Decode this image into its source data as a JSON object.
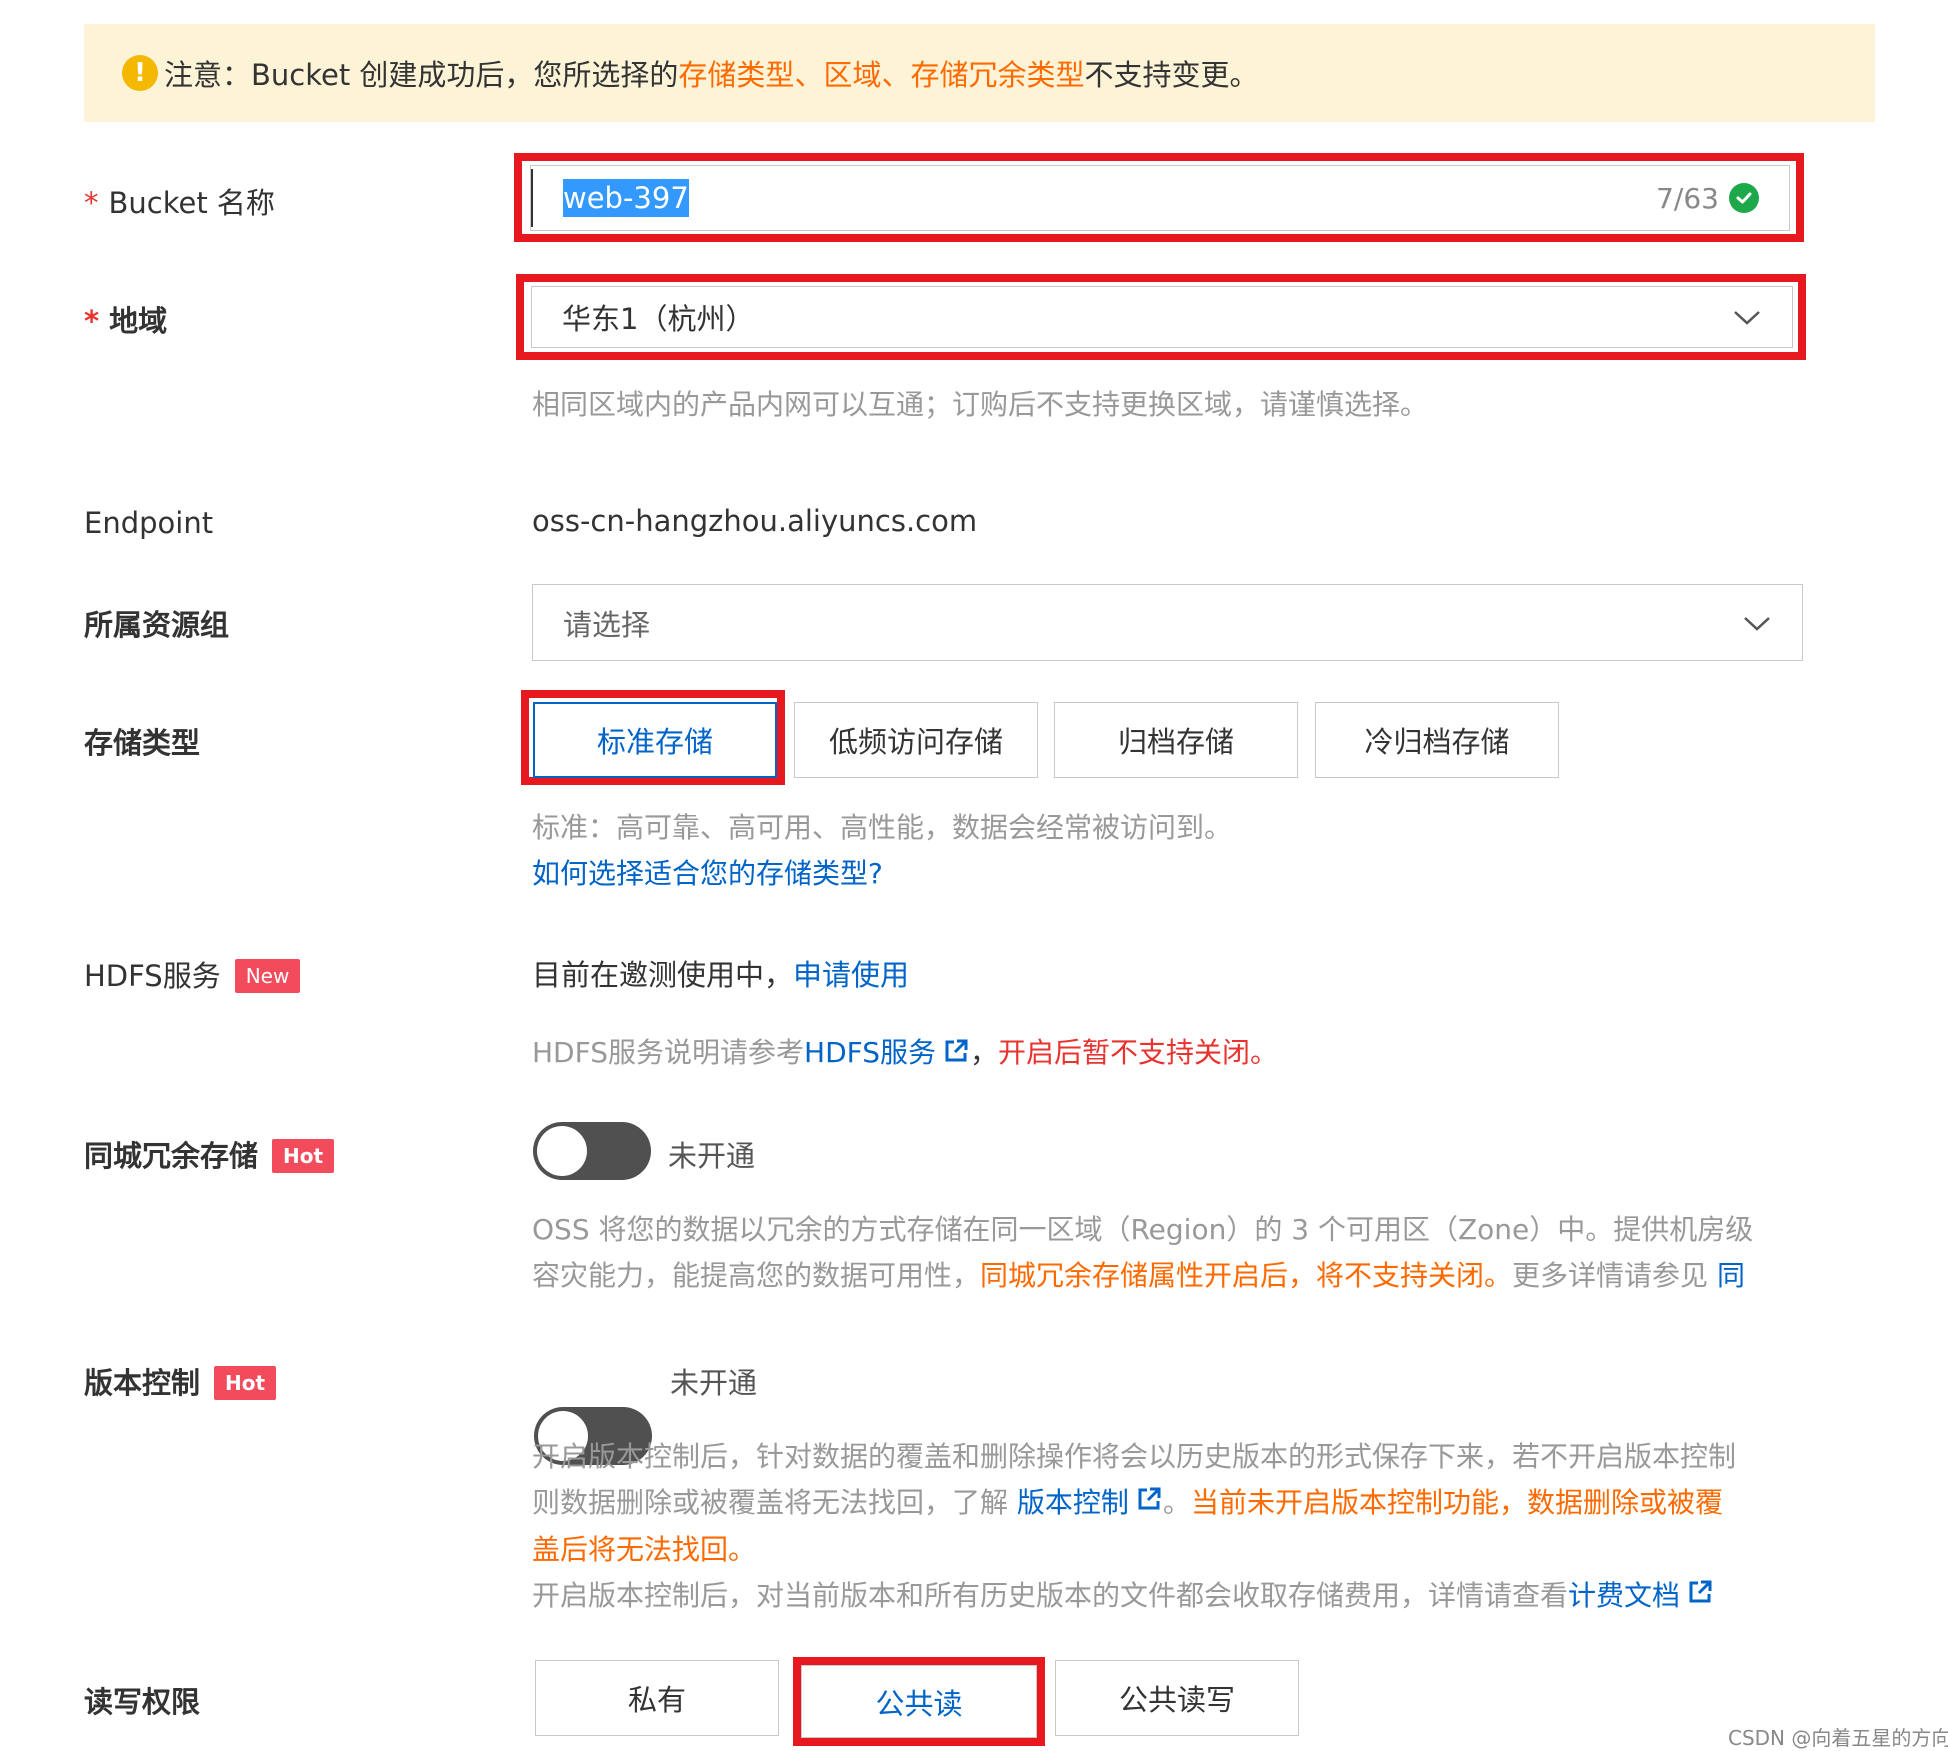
{
  "notice": {
    "prefix": "注意：Bucket 创建成功后，您所选择的 ",
    "storage_type": "存储类型",
    "sep1": "、",
    "region": "区域",
    "sep2": "、",
    "redundancy_type": "存储冗余类型",
    "suffix": " 不支持变更。"
  },
  "bucket_name": {
    "required_mark": "*",
    "label": "Bucket 名称",
    "value": "web-397",
    "counter": "7/63"
  },
  "region": {
    "required_mark": "*",
    "label": "地域",
    "value": "华东1（杭州）",
    "help": "相同区域内的产品内网可以互通；订购后不支持更换区域，请谨慎选择。"
  },
  "endpoint": {
    "label": "Endpoint",
    "value": "oss-cn-hangzhou.aliyuncs.com"
  },
  "resource_group": {
    "label": "所属资源组",
    "placeholder": "请选择"
  },
  "storage_class": {
    "label": "存储类型",
    "options": [
      "标准存储",
      "低频访问存储",
      "归档存储",
      "冷归档存储"
    ],
    "selected": "标准存储",
    "help": "标准：高可靠、高可用、高性能，数据会经常被访问到。",
    "link": "如何选择适合您的存储类型?"
  },
  "hdfs": {
    "label": "HDFS服务",
    "tag": "New",
    "status": "目前在邀测使用中，",
    "apply_link": "申请使用",
    "help_prefix": "HDFS服务说明请参考",
    "help_link": "HDFS服务",
    "help_sep": "，",
    "help_warning": "开启后暂不支持关闭。"
  },
  "zone_redundancy": {
    "label": "同城冗余存储",
    "tag": "Hot",
    "toggle_state": "未开通",
    "help_line1": "OSS 将您的数据以冗余的方式存储在同一区域（Region）的 3 个可用区（Zone）中。提供机房级",
    "help_line2_prefix": "容灾能力，能提高您的数据可用性，",
    "help_line2_warning": "同城冗余存储属性开启后，将不支持关闭。",
    "help_line2_suffix": "更多详情请参见 ",
    "help_line2_link": "同"
  },
  "versioning": {
    "label": "版本控制",
    "tag": "Hot",
    "toggle_state": "未开通",
    "help_line1": "开启版本控制后，针对数据的覆盖和删除操作将会以历史版本的形式保存下来，若不开启版本控制",
    "help_line2_prefix": "则数据删除或被覆盖将无法找回，了解 ",
    "help_line2_link": "版本控制",
    "help_line2_sep": "。",
    "help_line2_warning": "当前未开启版本控制功能，数据删除或被覆",
    "help_line3_warning": "盖后将无法找回。",
    "help_line4_prefix": "开启版本控制后，对当前版本和所有历史版本的文件都会收取存储费用，详情请查看",
    "help_line4_link": "计费文档"
  },
  "acl": {
    "label": "读写权限",
    "options": [
      "私有",
      "公共读",
      "公共读写"
    ],
    "selected": "公共读"
  },
  "watermark": "CSDN @向着五星的方向",
  "colors": {
    "highlight_box": "#e8181f",
    "link": "#0064c8",
    "warning_orange": "#ff6a00",
    "notice_bg": "#fdf4d8",
    "tag_bg": "#f24c5c"
  }
}
